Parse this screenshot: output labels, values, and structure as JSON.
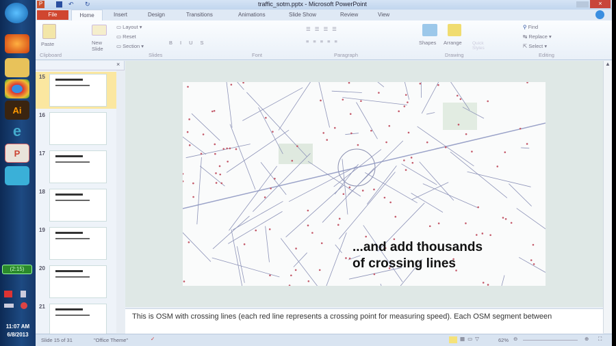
{
  "window_title": "traffic_sotm.pptx - Microsoft PowerPoint",
  "tabs": [
    "File",
    "Home",
    "Insert",
    "Design",
    "Transitions",
    "Animations",
    "Slide Show",
    "Review",
    "View"
  ],
  "ribbon": {
    "clipboard": {
      "paste": "Paste",
      "group": "Clipboard"
    },
    "slides": {
      "new_slide": "New Slide",
      "layout": "Layout",
      "reset": "Reset",
      "section": "Section",
      "group": "Slides"
    },
    "font_group": "Font",
    "paragraph_group": "Paragraph",
    "drawing": {
      "shapes": "Shapes",
      "arrange": "Arrange",
      "quick_styles": "Quick Styles",
      "group": "Drawing"
    },
    "editing": {
      "find": "Find",
      "replace": "Replace",
      "select": "Select",
      "group": "Editing"
    }
  },
  "thumbnails": [
    "15",
    "16",
    "17",
    "18",
    "19",
    "20",
    "21"
  ],
  "slide": {
    "caption_line1": "...and add thousands",
    "caption_line2": "of crossing lines"
  },
  "notes": "This is OSM with crossing lines (each red line represents a crossing point for measuring speed). Each OSM segment between",
  "status": {
    "slide": "Slide 15 of 31",
    "theme": "\"Office Theme\"",
    "zoom": "62%"
  },
  "taskbar": {
    "battery": "(2:15)",
    "time": "11:07 AM",
    "date": "6/8/2013"
  }
}
